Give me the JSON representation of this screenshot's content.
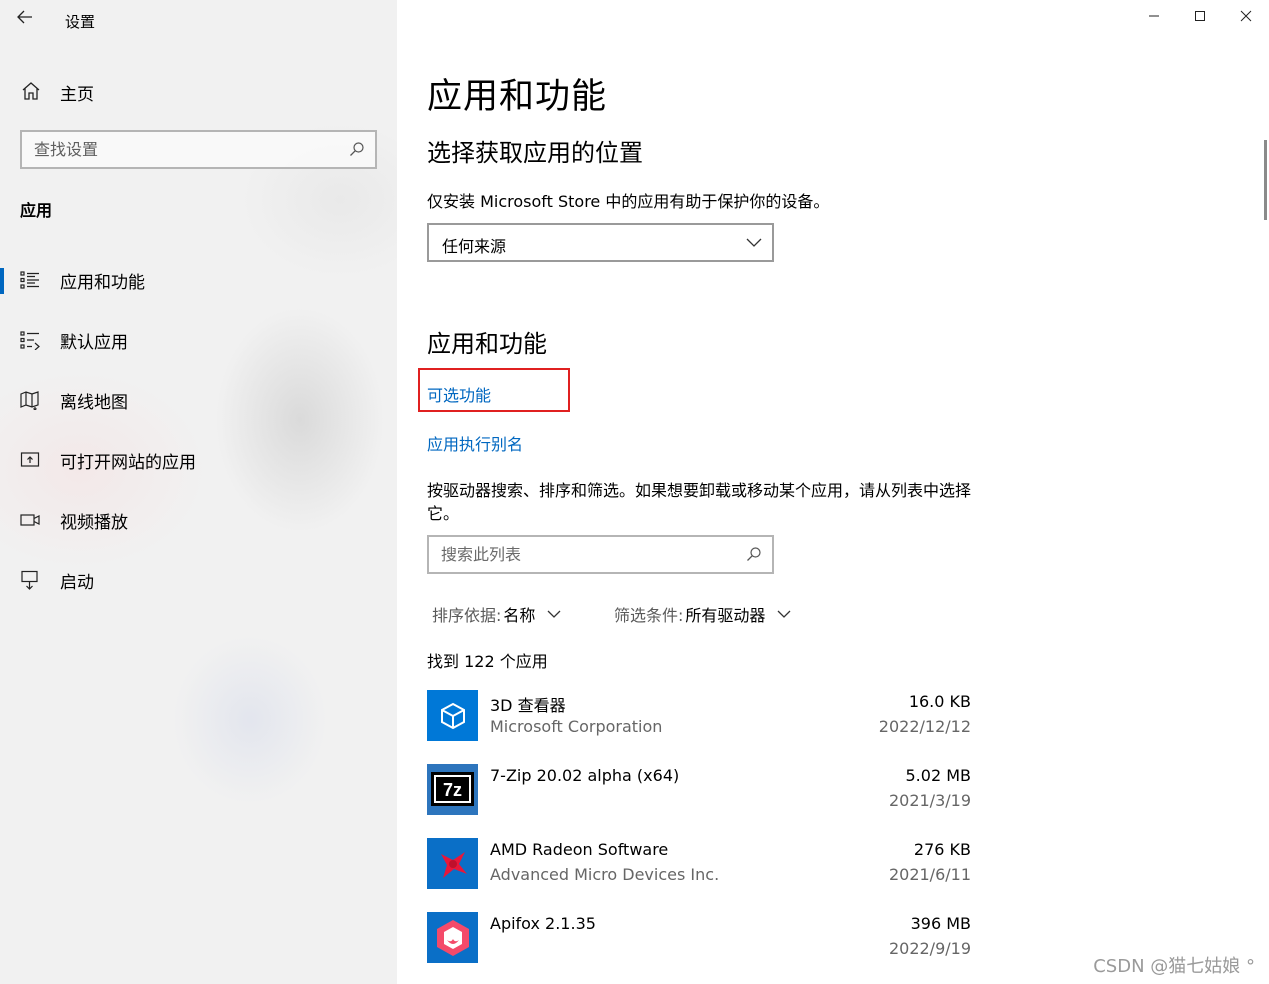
{
  "window": {
    "title": "设置",
    "controls": [
      "minimize",
      "maximize",
      "close"
    ]
  },
  "sidebar": {
    "home_label": "主页",
    "search_placeholder": "查找设置",
    "section_label": "应用",
    "items": [
      {
        "label": "应用和功能",
        "icon": "apps-features-icon",
        "selected": true
      },
      {
        "label": "默认应用",
        "icon": "default-apps-icon",
        "selected": false
      },
      {
        "label": "离线地图",
        "icon": "offline-maps-icon",
        "selected": false
      },
      {
        "label": "可打开网站的应用",
        "icon": "apps-for-websites-icon",
        "selected": false
      },
      {
        "label": "视频播放",
        "icon": "video-playback-icon",
        "selected": false
      },
      {
        "label": "启动",
        "icon": "startup-icon",
        "selected": false
      }
    ]
  },
  "main": {
    "page_title": "应用和功能",
    "install_section": {
      "heading": "选择获取应用的位置",
      "description": "仅安装 Microsoft Store 中的应用有助于保护你的设备。",
      "dropdown_value": "任何来源"
    },
    "apps_section": {
      "heading": "应用和功能",
      "link_optional_features": "可选功能",
      "link_app_aliases": "应用执行别名",
      "description": "按驱动器搜索、排序和筛选。如果想要卸载或移动某个应用，请从列表中选择它。",
      "search_placeholder": "搜索此列表",
      "sort_key": "排序依据:",
      "sort_value": "名称",
      "filter_key": "筛选条件:",
      "filter_value": "所有驱动器",
      "found_text": "找到 122 个应用"
    },
    "apps": [
      {
        "name": "3D 查看器",
        "publisher": "Microsoft Corporation",
        "size": "16.0 KB",
        "date": "2022/12/12",
        "icon": "3d-viewer-icon",
        "icon_color": "#0078d7"
      },
      {
        "name": "7-Zip 20.02 alpha (x64)",
        "publisher": "",
        "size": "5.02 MB",
        "date": "2021/3/19",
        "icon": "7zip-icon",
        "icon_color": "#2d75bd"
      },
      {
        "name": "AMD Radeon Software",
        "publisher": "Advanced Micro Devices Inc.",
        "size": "276 KB",
        "date": "2021/6/11",
        "icon": "amd-radeon-icon",
        "icon_color": "#0a6fc7"
      },
      {
        "name": "Apifox 2.1.35",
        "publisher": "",
        "size": "396 MB",
        "date": "2022/9/19",
        "icon": "apifox-icon",
        "icon_color": "#0a6fc7"
      }
    ]
  },
  "watermark": "CSDN @猫七姑娘 °",
  "colors": {
    "accent": "#0067c0",
    "highlight_box": "#e02020",
    "sidebar_bg": "#f1f1f1"
  }
}
